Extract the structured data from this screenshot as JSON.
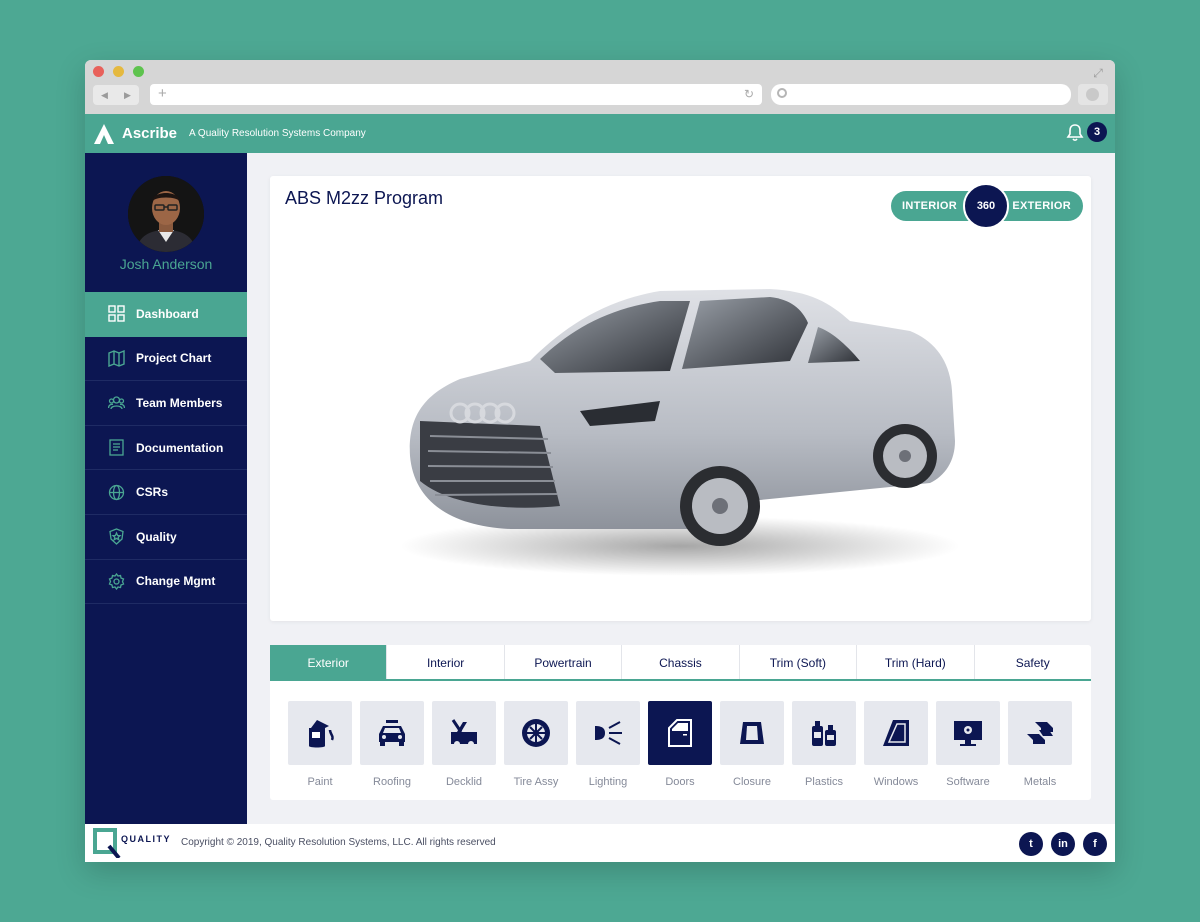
{
  "brand": {
    "name": "Ascribe",
    "tagline": "A Quality Resolution Systems Company",
    "accent": "#4aa692",
    "navy": "#0c1652"
  },
  "notifications": {
    "count": "3"
  },
  "user": {
    "name": "Josh Anderson"
  },
  "sidebar": {
    "items": [
      {
        "label": "Dashboard",
        "icon": "grid-icon",
        "active": true
      },
      {
        "label": "Project Chart",
        "icon": "map-icon"
      },
      {
        "label": "Team Members",
        "icon": "team-icon"
      },
      {
        "label": "Documentation",
        "icon": "document-icon"
      },
      {
        "label": "CSRs",
        "icon": "globe-icon"
      },
      {
        "label": "Quality",
        "icon": "badge-icon"
      },
      {
        "label": "Change Mgmt",
        "icon": "gear-icon"
      }
    ]
  },
  "main": {
    "title": "ABS M2zz Program",
    "toggle": {
      "left": "INTERIOR",
      "center": "360",
      "right": "EXTERIOR"
    }
  },
  "tabs": [
    "Exterior",
    "Interior",
    "Powertrain",
    "Chassis",
    "Trim (Soft)",
    "Trim (Hard)",
    "Safety"
  ],
  "categories": [
    {
      "label": "Paint",
      "icon": "paint-icon"
    },
    {
      "label": "Roofing",
      "icon": "car-roof-icon"
    },
    {
      "label": "Decklid",
      "icon": "decklid-icon"
    },
    {
      "label": "Tire Assy",
      "icon": "tire-icon"
    },
    {
      "label": "Lighting",
      "icon": "headlight-icon"
    },
    {
      "label": "Doors",
      "icon": "door-icon",
      "active": true
    },
    {
      "label": "Closure",
      "icon": "closure-icon"
    },
    {
      "label": "Plastics",
      "icon": "bottles-icon"
    },
    {
      "label": "Windows",
      "icon": "window-icon"
    },
    {
      "label": "Software",
      "icon": "monitor-icon"
    },
    {
      "label": "Metals",
      "icon": "ingots-icon"
    }
  ],
  "footer": {
    "logo_text": "QUALITY",
    "copyright": "Copyright © 2019, Quality Resolution Systems, LLC. All rights reserved",
    "social": [
      {
        "name": "twitter-icon",
        "glyph": "t"
      },
      {
        "name": "linkedin-icon",
        "glyph": "in"
      },
      {
        "name": "facebook-icon",
        "glyph": "f"
      }
    ]
  }
}
